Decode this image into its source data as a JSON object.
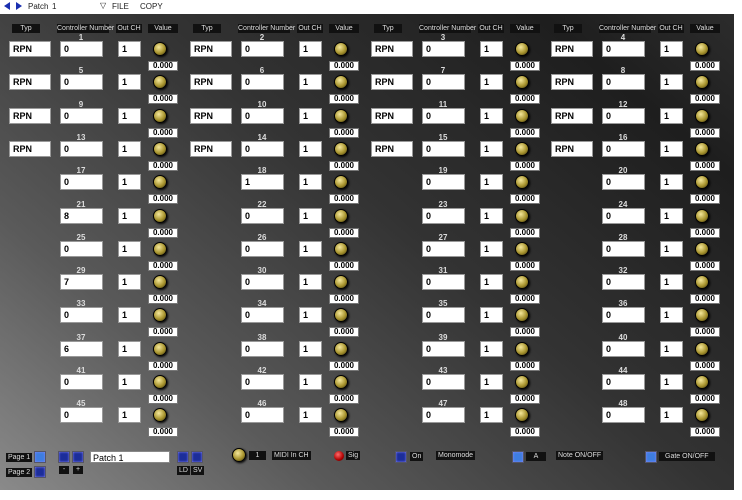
{
  "menubar": {
    "patch_label": "Patch",
    "patch_number": "1",
    "file": "FILE",
    "copy": "COPY"
  },
  "headers": {
    "typ": "Typ",
    "controller_number": "Controller Number",
    "out_ch": "Out CH",
    "value": "Value"
  },
  "controllers": [
    {
      "n": "1",
      "typ": "RPN",
      "cc": "0",
      "out": "1",
      "value": "0.000"
    },
    {
      "n": "2",
      "typ": "RPN",
      "cc": "0",
      "out": "1",
      "value": "0.000"
    },
    {
      "n": "3",
      "typ": "RPN",
      "cc": "0",
      "out": "1",
      "value": "0.000"
    },
    {
      "n": "4",
      "typ": "RPN",
      "cc": "0",
      "out": "1",
      "value": "0.000"
    },
    {
      "n": "5",
      "typ": "RPN",
      "cc": "0",
      "out": "1",
      "value": "0.000"
    },
    {
      "n": "6",
      "typ": "RPN",
      "cc": "0",
      "out": "1",
      "value": "0.000"
    },
    {
      "n": "7",
      "typ": "RPN",
      "cc": "0",
      "out": "1",
      "value": "0.000"
    },
    {
      "n": "8",
      "typ": "RPN",
      "cc": "0",
      "out": "1",
      "value": "0.000"
    },
    {
      "n": "9",
      "typ": "RPN",
      "cc": "0",
      "out": "1",
      "value": "0.000"
    },
    {
      "n": "10",
      "typ": "RPN",
      "cc": "0",
      "out": "1",
      "value": "0.000"
    },
    {
      "n": "11",
      "typ": "RPN",
      "cc": "0",
      "out": "1",
      "value": "0.000"
    },
    {
      "n": "12",
      "typ": "RPN",
      "cc": "0",
      "out": "1",
      "value": "0.000"
    },
    {
      "n": "13",
      "typ": "RPN",
      "cc": "0",
      "out": "1",
      "value": "0.000"
    },
    {
      "n": "14",
      "typ": "RPN",
      "cc": "0",
      "out": "1",
      "value": "0.000"
    },
    {
      "n": "15",
      "typ": "RPN",
      "cc": "0",
      "out": "1",
      "value": "0.000"
    },
    {
      "n": "16",
      "typ": "RPN",
      "cc": "0",
      "out": "1",
      "value": "0.000"
    },
    {
      "n": "17",
      "cc": "0",
      "out": "1",
      "value": "0.000"
    },
    {
      "n": "18",
      "cc": "1",
      "out": "1",
      "value": "0.000"
    },
    {
      "n": "19",
      "cc": "0",
      "out": "1",
      "value": "0.000"
    },
    {
      "n": "20",
      "cc": "0",
      "out": "1",
      "value": "0.000"
    },
    {
      "n": "21",
      "cc": "8",
      "out": "1",
      "value": "0.000"
    },
    {
      "n": "22",
      "cc": "0",
      "out": "1",
      "value": "0.000"
    },
    {
      "n": "23",
      "cc": "0",
      "out": "1",
      "value": "0.000"
    },
    {
      "n": "24",
      "cc": "0",
      "out": "1",
      "value": "0.000"
    },
    {
      "n": "25",
      "cc": "0",
      "out": "1",
      "value": "0.000"
    },
    {
      "n": "26",
      "cc": "0",
      "out": "1",
      "value": "0.000"
    },
    {
      "n": "27",
      "cc": "0",
      "out": "1",
      "value": "0.000"
    },
    {
      "n": "28",
      "cc": "0",
      "out": "1",
      "value": "0.000"
    },
    {
      "n": "29",
      "cc": "7",
      "out": "1",
      "value": "0.000"
    },
    {
      "n": "30",
      "cc": "0",
      "out": "1",
      "value": "0.000"
    },
    {
      "n": "31",
      "cc": "0",
      "out": "1",
      "value": "0.000"
    },
    {
      "n": "32",
      "cc": "0",
      "out": "1",
      "value": "0.000"
    },
    {
      "n": "33",
      "cc": "0",
      "out": "1",
      "value": "0.000"
    },
    {
      "n": "34",
      "cc": "0",
      "out": "1",
      "value": "0.000"
    },
    {
      "n": "35",
      "cc": "0",
      "out": "1",
      "value": "0.000"
    },
    {
      "n": "36",
      "cc": "0",
      "out": "1",
      "value": "0.000"
    },
    {
      "n": "37",
      "cc": "6",
      "out": "1",
      "value": "0.000"
    },
    {
      "n": "38",
      "cc": "0",
      "out": "1",
      "value": "0.000"
    },
    {
      "n": "39",
      "cc": "0",
      "out": "1",
      "value": "0.000"
    },
    {
      "n": "40",
      "cc": "0",
      "out": "1",
      "value": "0.000"
    },
    {
      "n": "41",
      "cc": "0",
      "out": "1",
      "value": "0.000"
    },
    {
      "n": "42",
      "cc": "0",
      "out": "1",
      "value": "0.000"
    },
    {
      "n": "43",
      "cc": "0",
      "out": "1",
      "value": "0.000"
    },
    {
      "n": "44",
      "cc": "0",
      "out": "1",
      "value": "0.000"
    },
    {
      "n": "45",
      "cc": "0",
      "out": "1",
      "value": "0.000"
    },
    {
      "n": "46",
      "cc": "0",
      "out": "1",
      "value": "0.000"
    },
    {
      "n": "47",
      "cc": "0",
      "out": "1",
      "value": "0.000"
    },
    {
      "n": "48",
      "cc": "0",
      "out": "1",
      "value": "0.000"
    }
  ],
  "footer": {
    "page1": "Page 1",
    "page2": "Page 2",
    "minus": "-",
    "plus": "+",
    "patch_name": "Patch   1",
    "ld": "LD",
    "sv": "SV",
    "midi_in_ch_value": "1",
    "midi_in_ch": "MIDI In CH",
    "sig": "Sig",
    "mono_value": "On",
    "monomode": "Monomode",
    "note_value": "A",
    "note_onoff": "Note ON/OFF",
    "gate_onoff": "Gate ON/OFF"
  }
}
